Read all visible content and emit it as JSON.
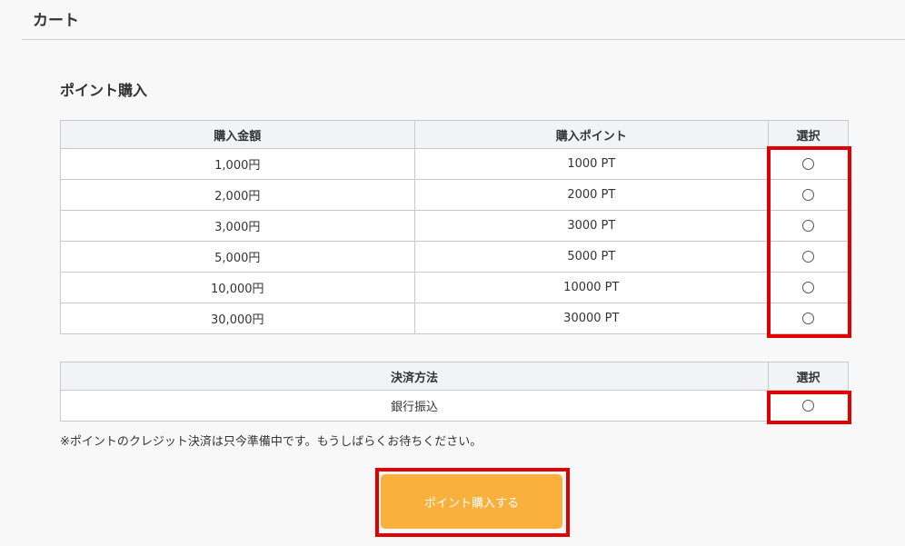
{
  "header": {
    "title": "カート"
  },
  "section": {
    "title": "ポイント購入"
  },
  "points_table": {
    "headers": [
      "購入金額",
      "購入ポイント",
      "選択"
    ],
    "rows": [
      {
        "amount": "1,000円",
        "points": "1000 PT"
      },
      {
        "amount": "2,000円",
        "points": "2000 PT"
      },
      {
        "amount": "3,000円",
        "points": "3000 PT"
      },
      {
        "amount": "5,000円",
        "points": "5000 PT"
      },
      {
        "amount": "10,000円",
        "points": "10000 PT"
      },
      {
        "amount": "30,000円",
        "points": "30000 PT"
      }
    ]
  },
  "payment_table": {
    "headers": [
      "決済方法",
      "選択"
    ],
    "rows": [
      {
        "method": "銀行振込"
      }
    ]
  },
  "note": "※ポイントのクレジット決済は只今準備中です。もうしばらくお待ちください。",
  "button": {
    "label": "ポイント購入する"
  },
  "colors": {
    "accent": "#fab03c",
    "highlight": "#e00000",
    "header_bg": "#f1f3f7"
  }
}
